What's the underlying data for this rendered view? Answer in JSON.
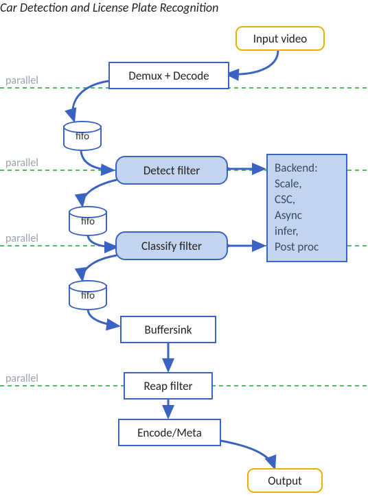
{
  "title": "Car Detection and License Plate Recognition",
  "labels": {
    "parallel": "parallel",
    "fifo": "fifo"
  },
  "nodes": {
    "input_video": "Input video",
    "demux_decode": "Demux + Decode",
    "detect_filter": "Detect filter",
    "classify_filter": "Classify filter",
    "buffersink": "Buffersink",
    "reap_filter": "Reap filter",
    "encode_meta": "Encode/Meta",
    "output": "Output"
  },
  "backend": {
    "title": "Backend:",
    "lines": [
      "Scale,",
      "CSC,",
      "Async",
      "infer,",
      "Post proc"
    ]
  },
  "colors": {
    "green_dash": "#4fbf63",
    "blue_arrow": "#3a63c2"
  }
}
